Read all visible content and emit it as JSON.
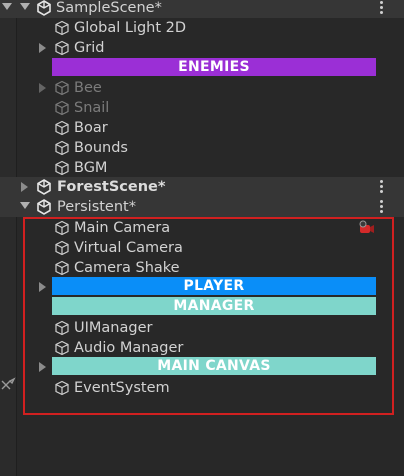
{
  "hierarchy": {
    "rows": [
      {
        "key": "sample_scene",
        "label": "SampleScene*"
      },
      {
        "key": "global_light",
        "label": "Global Light 2D"
      },
      {
        "key": "grid",
        "label": "Grid"
      },
      {
        "key": "enemies_header",
        "label": "ENEMIES"
      },
      {
        "key": "bee",
        "label": "Bee"
      },
      {
        "key": "snail",
        "label": "Snail"
      },
      {
        "key": "boar",
        "label": "Boar"
      },
      {
        "key": "bounds",
        "label": "Bounds"
      },
      {
        "key": "bgm",
        "label": "BGM"
      },
      {
        "key": "forest_scene",
        "label": "ForestScene*"
      },
      {
        "key": "persistent",
        "label": "Persistent*"
      },
      {
        "key": "main_camera",
        "label": "Main Camera"
      },
      {
        "key": "virtual_camera",
        "label": "Virtual Camera"
      },
      {
        "key": "camera_shake",
        "label": "Camera Shake"
      },
      {
        "key": "player_header",
        "label": "PLAYER"
      },
      {
        "key": "manager_header",
        "label": "MANAGER"
      },
      {
        "key": "ui_manager",
        "label": "UIManager"
      },
      {
        "key": "audio_manager",
        "label": "Audio Manager"
      },
      {
        "key": "main_canvas_header",
        "label": "MAIN CANVAS"
      },
      {
        "key": "event_system",
        "label": "EventSystem"
      }
    ]
  },
  "colors": {
    "enemies_bar": "#9b2fd6",
    "player_bar": "#0a8ef8",
    "manager_bar": "#7fd6cb",
    "main_canvas_bar": "#7fd6cb",
    "selection_outline": "#d12020"
  },
  "icons": {
    "scene": "unity-scene-icon",
    "gameobject": "cube-icon",
    "menu": "kebab-menu-icon",
    "gizmo": "camera-gizmo-icon"
  }
}
